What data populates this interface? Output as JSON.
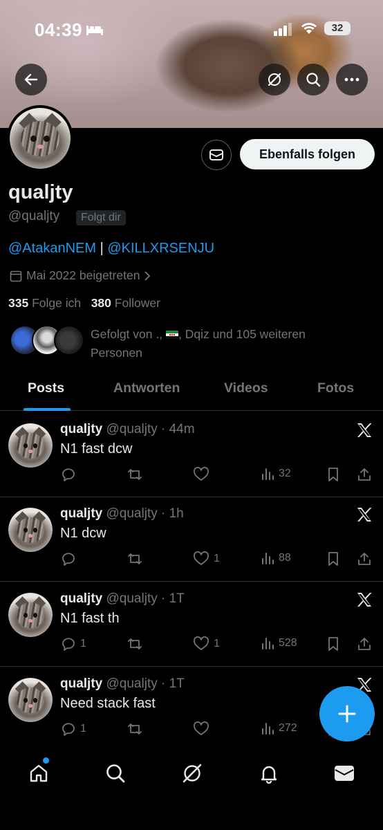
{
  "status_bar": {
    "time": "04:39",
    "battery": "32"
  },
  "profile": {
    "name": "qualjty",
    "handle": "@qualjty",
    "follows_you_badge": "Folgt dir",
    "bio_links": [
      "@AtakanNEM",
      "@KILLXRSENJU"
    ],
    "bio_separator": " | ",
    "joined": "Mai 2022 beigetreten",
    "following_count": "335",
    "following_label": "Folge ich",
    "followers_count": "380",
    "followers_label": "Follower",
    "followed_by_prefix": "Gefolgt von .,",
    "followed_by_suffix": ", Dqiz und 105 weiteren Personen",
    "follow_button": "Ebenfalls folgen"
  },
  "tabs": [
    {
      "label": "Posts",
      "active": true
    },
    {
      "label": "Antworten",
      "active": false
    },
    {
      "label": "Videos",
      "active": false
    },
    {
      "label": "Fotos",
      "active": false
    }
  ],
  "posts": [
    {
      "name": "qualjty",
      "meta": "@qualjty · 44m",
      "text": "N1 fast dcw",
      "replies": "",
      "reposts": "",
      "likes": "",
      "views": "32"
    },
    {
      "name": "qualjty",
      "meta": "@qualjty · 1h",
      "text": "N1 dcw",
      "replies": "",
      "reposts": "",
      "likes": "1",
      "views": "88"
    },
    {
      "name": "qualjty",
      "meta": "@qualjty · 1T",
      "text": "N1 fast th",
      "replies": "1",
      "reposts": "",
      "likes": "1",
      "views": "528"
    },
    {
      "name": "qualjty",
      "meta": "@qualjty · 1T",
      "text": "Need stack fast",
      "replies": "1",
      "reposts": "",
      "likes": "",
      "views": "272"
    }
  ],
  "colors": {
    "accent": "#1d9bf0",
    "background": "#000000",
    "muted": "#71767b",
    "text": "#e7e9ea"
  },
  "icons": {
    "header": [
      "back-arrow-icon",
      "grok-icon",
      "search-icon",
      "more-icon"
    ],
    "bottom_nav": [
      "home-icon",
      "search-icon",
      "grok-icon",
      "notifications-icon",
      "messages-icon"
    ]
  }
}
